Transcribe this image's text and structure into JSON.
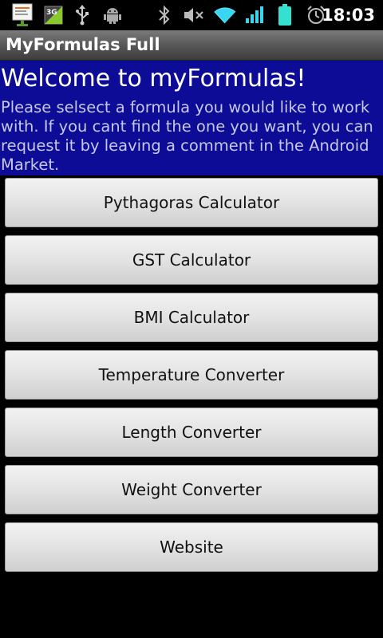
{
  "status_bar": {
    "time": "18:03",
    "network_type": "3G",
    "icons": [
      "notification-icon",
      "3g-signal-icon",
      "usb-icon",
      "android-debug-icon",
      "bluetooth-icon",
      "mute-icon",
      "wifi-icon",
      "cell-signal-icon",
      "battery-icon",
      "alarm-icon"
    ]
  },
  "app": {
    "title": "MyFormulas Full"
  },
  "welcome": {
    "heading": "Welcome to myFormulas!",
    "message": "Please selsect a formula you would like to work with. If you cant find the one you want, you can request it by leaving a comment in the Android Market."
  },
  "buttons": [
    {
      "label": "Pythagoras Calculator"
    },
    {
      "label": "GST Calculator"
    },
    {
      "label": "BMI Calculator"
    },
    {
      "label": "Temperature Converter"
    },
    {
      "label": "Length Converter"
    },
    {
      "label": "Weight Converter"
    },
    {
      "label": "Website"
    }
  ],
  "colors": {
    "welcome_background": "#0c0c96",
    "battery": "#34e0d0",
    "signal": "#3ad6f0"
  }
}
